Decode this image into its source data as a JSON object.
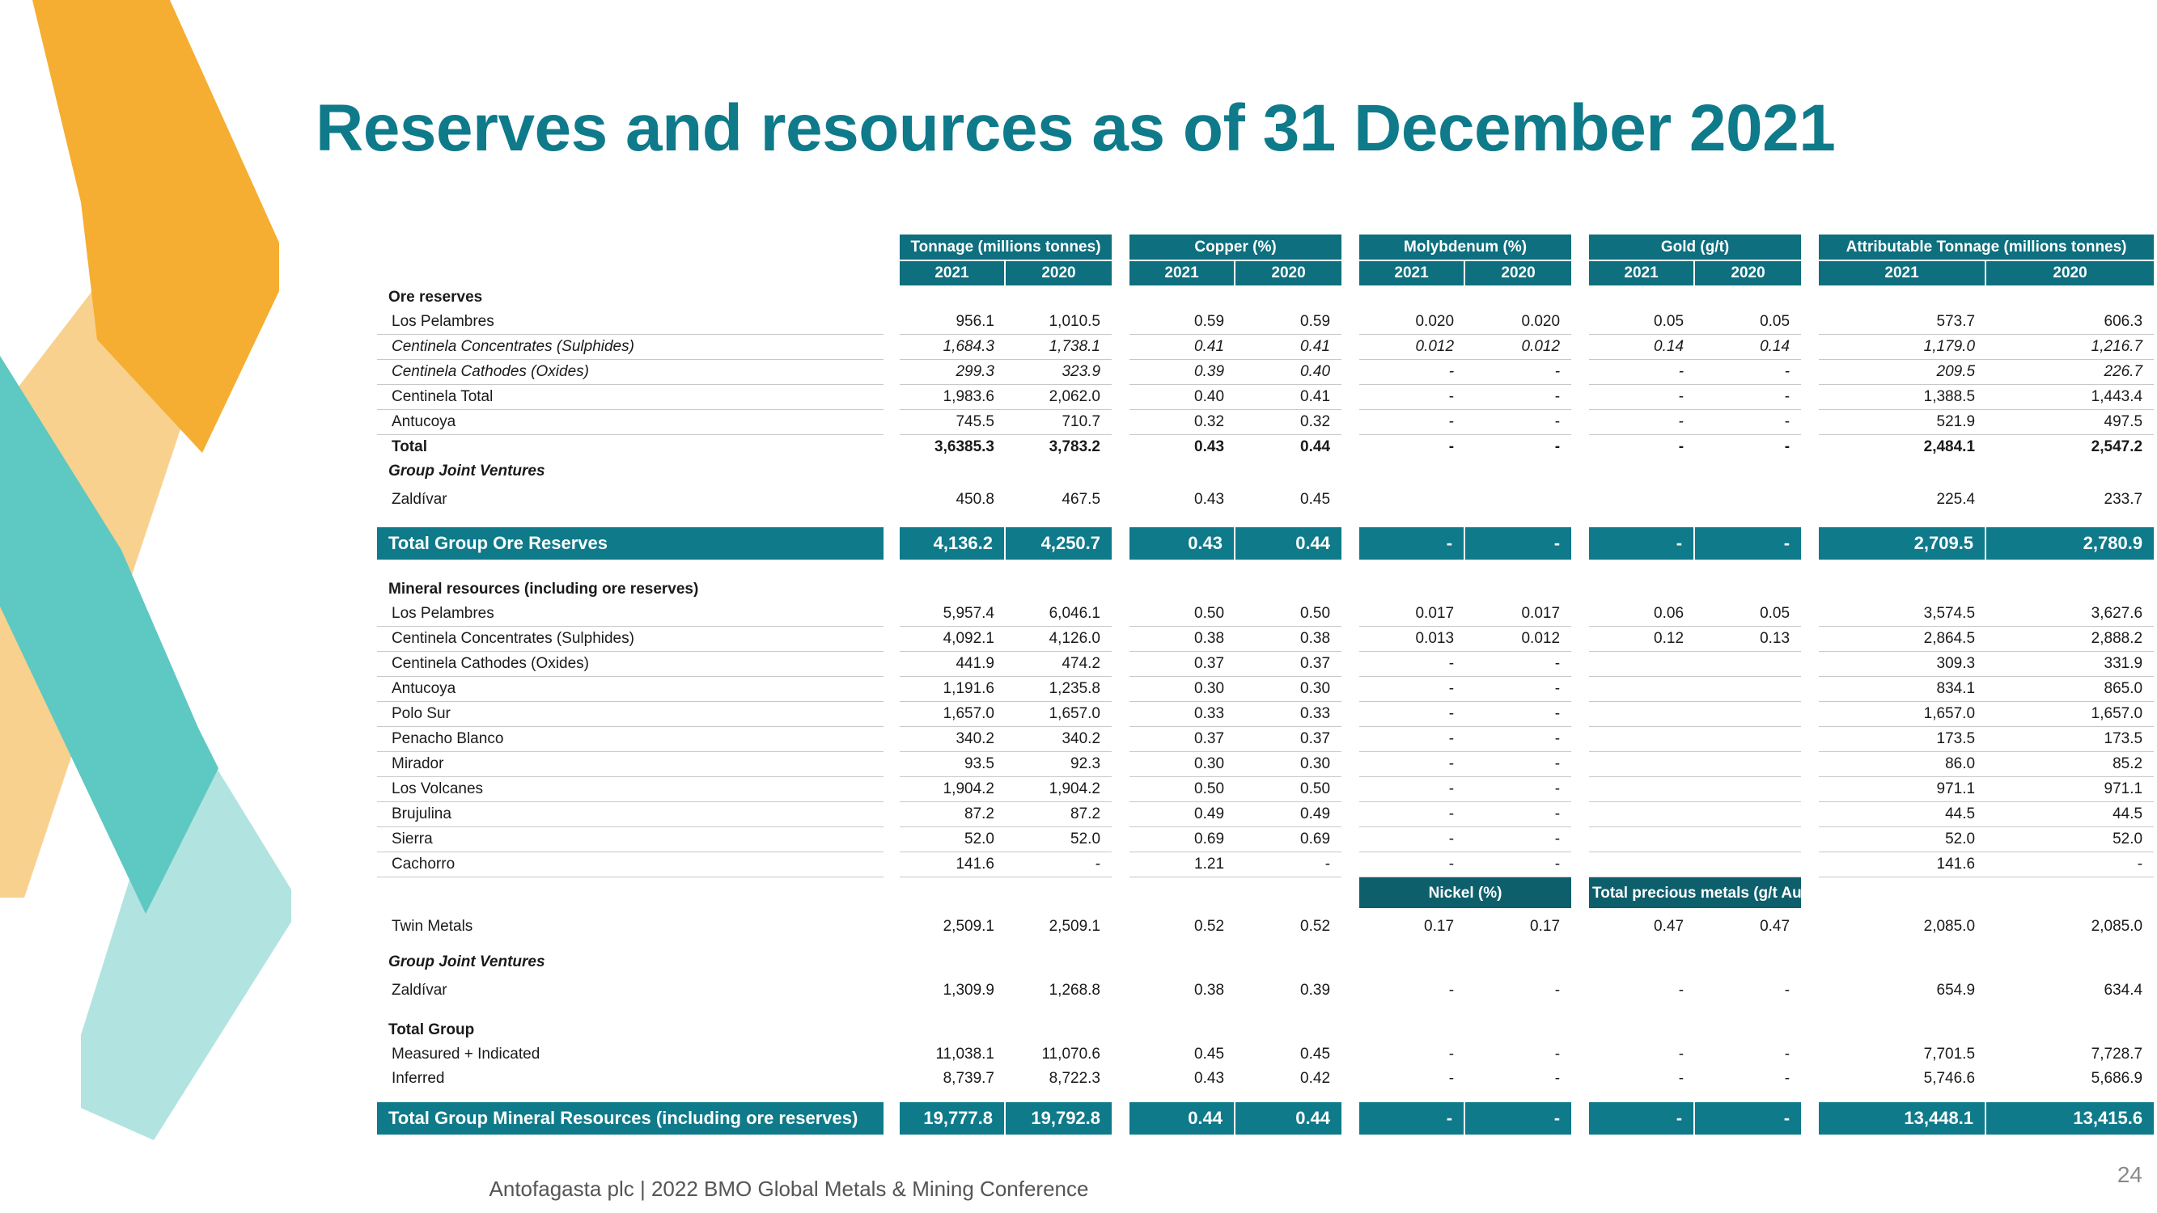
{
  "title": "Reserves and resources as of 31 December 2021",
  "footer": "Antofagasta plc | 2022 BMO Global Metals & Mining Conference",
  "page_number": "24",
  "colors": {
    "teal_dark": "#0e6f7e",
    "teal": "#0e7a8a",
    "orange": "#f5ae31",
    "light_orange": "#f8d18f",
    "aqua": "#5ec8c3",
    "light_aqua": "#b1e3e1"
  },
  "headers": {
    "groups": [
      "Tonnage (millions tonnes)",
      "Copper (%)",
      "Molybdenum (%)",
      "Gold (g/t)",
      "Attributable Tonnage (millions tonnes)"
    ],
    "years": [
      "2021",
      "2020",
      "2021",
      "2020",
      "2021",
      "2020",
      "2021",
      "2020",
      "2021",
      "2020"
    ],
    "sub_groups": [
      "Nickel (%)",
      "Total precious metals (g/t Au+Pt+Pd)"
    ]
  },
  "rows": [
    {
      "section": "Ore reserves"
    },
    {
      "label": "Los Pelambres",
      "v": [
        "956.1",
        "1,010.5",
        "0.59",
        "0.59",
        "0.020",
        "0.020",
        "0.05",
        "0.05",
        "573.7",
        "606.3"
      ]
    },
    {
      "label": "Centinela Concentrates (Sulphides)",
      "v": [
        "1,684.3",
        "1,738.1",
        "0.41",
        "0.41",
        "0.012",
        "0.012",
        "0.14",
        "0.14",
        "1,179.0",
        "1,216.7"
      ]
    },
    {
      "label": "Centinela Cathodes (Oxides)",
      "v": [
        "299.3",
        "323.9",
        "0.39",
        "0.40",
        "-",
        "-",
        "-",
        "-",
        "209.5",
        "226.7"
      ]
    },
    {
      "label": "Centinela Total",
      "v": [
        "1,983.6",
        "2,062.0",
        "0.40",
        "0.41",
        "-",
        "-",
        "-",
        "-",
        "1,388.5",
        "1,443.4"
      ]
    },
    {
      "label": "Antucoya",
      "v": [
        "745.5",
        "710.7",
        "0.32",
        "0.32",
        "-",
        "-",
        "-",
        "-",
        "521.9",
        "497.5"
      ]
    },
    {
      "label": "Total",
      "v": [
        "3,6385.3",
        "3,783.2",
        "0.43",
        "0.44",
        "-",
        "-",
        "-",
        "-",
        "2,484.1",
        "2,547.2"
      ]
    },
    {
      "section": "Group Joint Ventures"
    },
    {
      "label": "Zaldívar",
      "v": [
        "450.8",
        "467.5",
        "0.43",
        "0.45",
        "",
        "",
        "",
        "",
        "225.4",
        "233.7"
      ]
    },
    {
      "total_label": "Total Group Ore Reserves",
      "v": [
        "4,136.2",
        "4,250.7",
        "0.43",
        "0.44",
        "-",
        "-",
        "-",
        "-",
        "2,709.5",
        "2,780.9"
      ]
    },
    {
      "section": "Mineral resources (including ore reserves)"
    },
    {
      "label": "Los Pelambres",
      "v": [
        "5,957.4",
        "6,046.1",
        "0.50",
        "0.50",
        "0.017",
        "0.017",
        "0.06",
        "0.05",
        "3,574.5",
        "3,627.6"
      ]
    },
    {
      "label": "Centinela Concentrates (Sulphides)",
      "v": [
        "4,092.1",
        "4,126.0",
        "0.38",
        "0.38",
        "0.013",
        "0.012",
        "0.12",
        "0.13",
        "2,864.5",
        "2,888.2"
      ]
    },
    {
      "label": "Centinela Cathodes (Oxides)",
      "v": [
        "441.9",
        "474.2",
        "0.37",
        "0.37",
        "-",
        "-",
        "",
        "",
        "309.3",
        "331.9"
      ]
    },
    {
      "label": "Antucoya",
      "v": [
        "1,191.6",
        "1,235.8",
        "0.30",
        "0.30",
        "-",
        "-",
        "",
        "",
        "834.1",
        "865.0"
      ]
    },
    {
      "label": "Polo Sur",
      "v": [
        "1,657.0",
        "1,657.0",
        "0.33",
        "0.33",
        "-",
        "-",
        "",
        "",
        "1,657.0",
        "1,657.0"
      ]
    },
    {
      "label": "Penacho Blanco",
      "v": [
        "340.2",
        "340.2",
        "0.37",
        "0.37",
        "-",
        "-",
        "",
        "",
        "173.5",
        "173.5"
      ]
    },
    {
      "label": "Mirador",
      "v": [
        "93.5",
        "92.3",
        "0.30",
        "0.30",
        "-",
        "-",
        "",
        "",
        "86.0",
        "85.2"
      ]
    },
    {
      "label": "Los Volcanes",
      "v": [
        "1,904.2",
        "1,904.2",
        "0.50",
        "0.50",
        "-",
        "-",
        "",
        "",
        "971.1",
        "971.1"
      ]
    },
    {
      "label": "Brujulina",
      "v": [
        "87.2",
        "87.2",
        "0.49",
        "0.49",
        "-",
        "-",
        "",
        "",
        "44.5",
        "44.5"
      ]
    },
    {
      "label": "Sierra",
      "v": [
        "52.0",
        "52.0",
        "0.69",
        "0.69",
        "-",
        "-",
        "",
        "",
        "52.0",
        "52.0"
      ]
    },
    {
      "label": "Cachorro",
      "v": [
        "141.6",
        "-",
        "1.21",
        "-",
        "-",
        "-",
        "",
        "",
        "141.6",
        "-"
      ]
    },
    {
      "label": "Twin Metals",
      "v": [
        "2,509.1",
        "2,509.1",
        "0.52",
        "0.52",
        "0.17",
        "0.17",
        "0.47",
        "0.47",
        "2,085.0",
        "2,085.0"
      ]
    },
    {
      "section": "Group Joint Ventures"
    },
    {
      "label": "Zaldívar",
      "v": [
        "1,309.9",
        "1,268.8",
        "0.38",
        "0.39",
        "-",
        "-",
        "-",
        "-",
        "654.9",
        "634.4"
      ]
    },
    {
      "section": "Total Group"
    },
    {
      "label": "Measured + Indicated",
      "v": [
        "11,038.1",
        "11,070.6",
        "0.45",
        "0.45",
        "-",
        "-",
        "-",
        "-",
        "7,701.5",
        "7,728.7"
      ]
    },
    {
      "label": "Inferred",
      "v": [
        "8,739.7",
        "8,722.3",
        "0.43",
        "0.42",
        "-",
        "-",
        "-",
        "-",
        "5,746.6",
        "5,686.9"
      ]
    },
    {
      "total_label": "Total Group Mineral Resources (including ore reserves)",
      "v": [
        "19,777.8",
        "19,792.8",
        "0.44",
        "0.44",
        "-",
        "-",
        "-",
        "-",
        "13,448.1",
        "13,415.6"
      ]
    }
  ]
}
